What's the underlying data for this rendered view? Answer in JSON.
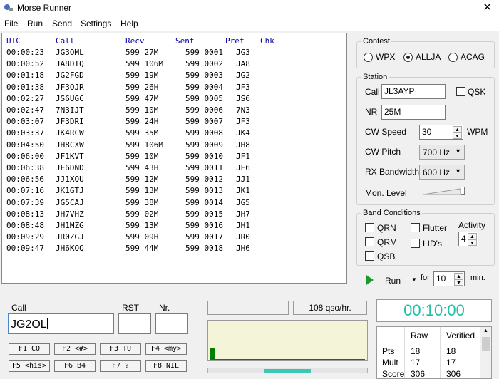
{
  "window": {
    "title": "Morse Runner",
    "close_glyph": "✕"
  },
  "menu": [
    "File",
    "Run",
    "Send",
    "Settings",
    "Help"
  ],
  "log": {
    "headers": [
      "UTC",
      "Call",
      "Recv",
      "Sent",
      "Pref",
      "Chk"
    ],
    "rows": [
      [
        "00:00:23",
        "JG3OML",
        "599 27M",
        "599 0001",
        "JG3"
      ],
      [
        "00:00:52",
        "JA8DIQ",
        "599 106M",
        "599 0002",
        "JA8"
      ],
      [
        "00:01:18",
        "JG2FGD",
        "599 19M",
        "599 0003",
        "JG2"
      ],
      [
        "00:01:38",
        "JF3QJR",
        "599 26H",
        "599 0004",
        "JF3"
      ],
      [
        "00:02:27",
        "JS6UGC",
        "599 47M",
        "599 0005",
        "JS6"
      ],
      [
        "00:02:47",
        "7N3IJT",
        "599 10M",
        "599 0006",
        "7N3"
      ],
      [
        "00:03:07",
        "JF3DRI",
        "599 24H",
        "599 0007",
        "JF3"
      ],
      [
        "00:03:37",
        "JK4RCW",
        "599 35M",
        "599 0008",
        "JK4"
      ],
      [
        "00:04:50",
        "JH8CXW",
        "599 106M",
        "599 0009",
        "JH8"
      ],
      [
        "00:06:00",
        "JF1KVT",
        "599 10M",
        "599 0010",
        "JF1"
      ],
      [
        "00:06:38",
        "JE6DND",
        "599 43H",
        "599 0011",
        "JE6"
      ],
      [
        "00:06:56",
        "JJ1XQU",
        "599 12M",
        "599 0012",
        "JJ1"
      ],
      [
        "00:07:16",
        "JK1GTJ",
        "599 13M",
        "599 0013",
        "JK1"
      ],
      [
        "00:07:39",
        "JG5CAJ",
        "599 38M",
        "599 0014",
        "JG5"
      ],
      [
        "00:08:13",
        "JH7VHZ",
        "599 02M",
        "599 0015",
        "JH7"
      ],
      [
        "00:08:48",
        "JH1MZG",
        "599 13M",
        "599 0016",
        "JH1"
      ],
      [
        "00:09:29",
        "JR0ZGJ",
        "599 09H",
        "599 0017",
        "JR0"
      ],
      [
        "00:09:47",
        "JH6KOQ",
        "599 44M",
        "599 0018",
        "JH6"
      ]
    ]
  },
  "contest": {
    "legend": "Contest",
    "options": [
      {
        "label": "WPX",
        "selected": false
      },
      {
        "label": "ALLJA",
        "selected": true
      },
      {
        "label": "ACAG",
        "selected": false
      }
    ]
  },
  "station": {
    "legend": "Station",
    "call_label": "Call",
    "call_value": "JL3AYP",
    "qsk_label": "QSK",
    "nr_label": "NR",
    "nr_value": "25M",
    "cw_speed_label": "CW Speed",
    "cw_speed_value": "30",
    "wpm_label": "WPM",
    "cw_pitch_label": "CW Pitch",
    "cw_pitch_value": "700 Hz",
    "rx_bw_label": "RX Bandwidth",
    "rx_bw_value": "600 Hz",
    "mon_level_label": "Mon. Level"
  },
  "band": {
    "legend": "Band Conditions",
    "qrn": "QRN",
    "flutter": "Flutter",
    "qrm": "QRM",
    "lids": "LID's",
    "qsb": "QSB",
    "activity_label": "Activity",
    "activity_value": "4"
  },
  "run": {
    "label": "Run",
    "for_label": "for",
    "minutes_value": "10",
    "min_label": "min."
  },
  "entry": {
    "call_label": "Call",
    "call_value": "JG2OL",
    "rst_label": "RST",
    "rst_value": "",
    "nr_label": "Nr.",
    "nr_value": ""
  },
  "fkeys": [
    [
      "F1 CQ",
      "F2 <#>",
      "F3 TU",
      "F4 <my>"
    ],
    [
      "F5 <his>",
      "F6 B4",
      "F7 ?",
      "F8 NIL"
    ]
  ],
  "rate": {
    "qso_hr": "108 qso/hr."
  },
  "timer": "00:10:00",
  "score": {
    "headers": [
      "Raw",
      "Verified"
    ],
    "rows": [
      [
        "Pts",
        "18",
        "18"
      ],
      [
        "Mult",
        "17",
        "17"
      ],
      [
        "Score",
        "306",
        "306"
      ]
    ]
  },
  "colors": {
    "header_blue": "#0000aa",
    "timer_teal": "#20c0a8",
    "signal_green": "#008000"
  }
}
